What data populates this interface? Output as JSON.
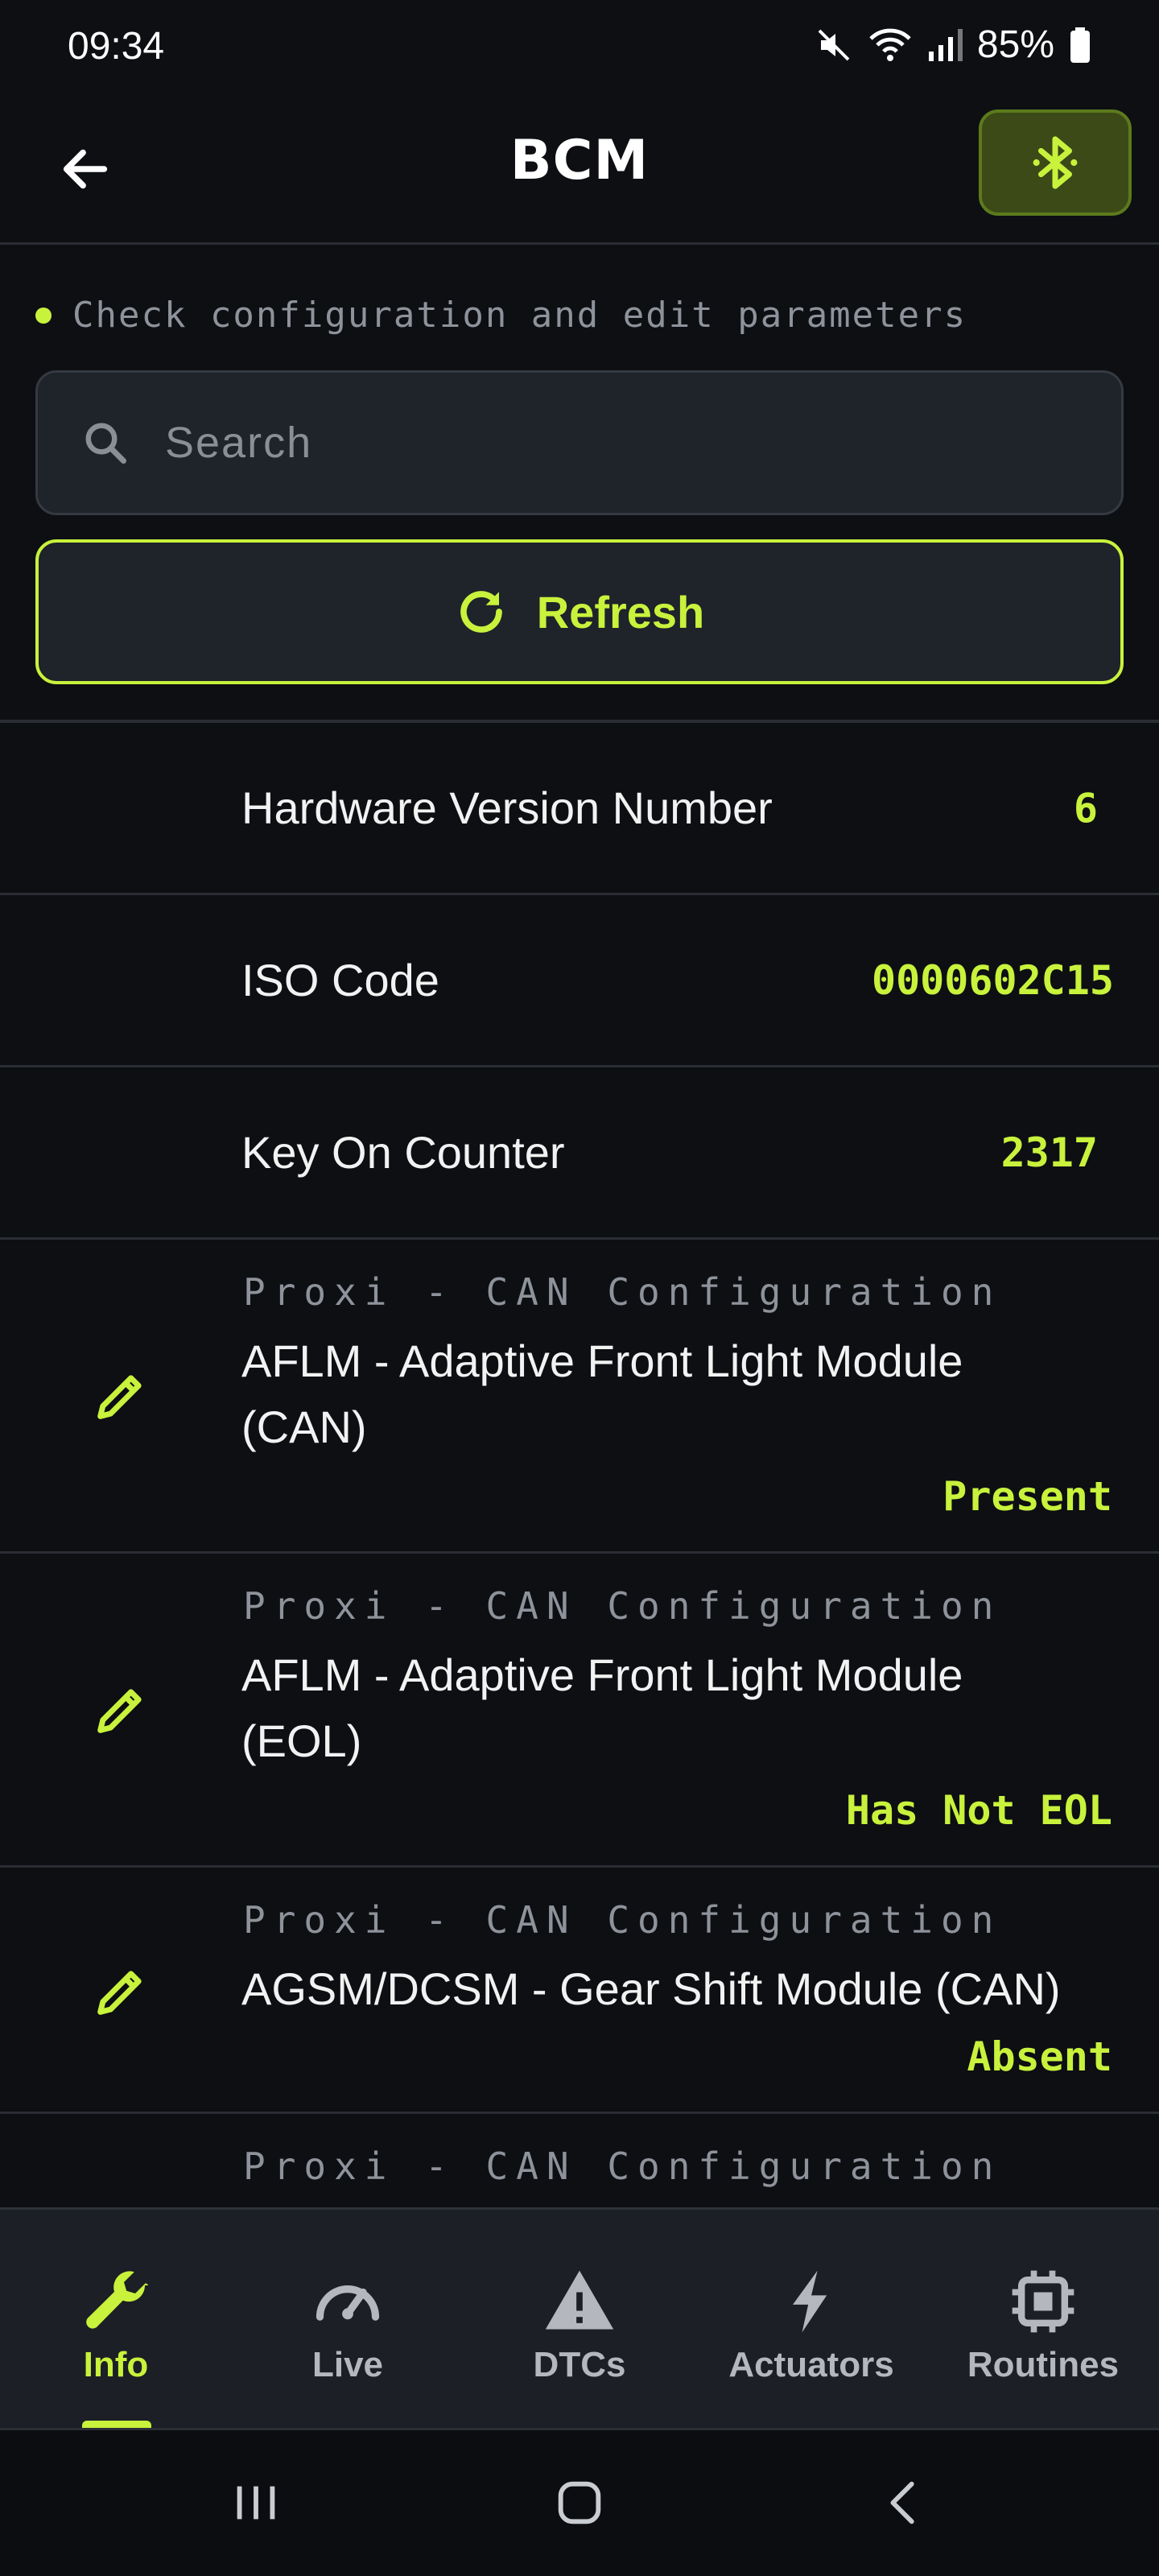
{
  "status_bar": {
    "time": "09:34",
    "battery": "85%",
    "icons": [
      "mute-icon",
      "wifi-icon",
      "signal-icon",
      "battery-icon"
    ]
  },
  "header": {
    "title": "BCM",
    "back_icon": "arrow-left-icon",
    "bluetooth_icon": "bluetooth-icon"
  },
  "subtitle": "Check configuration and edit parameters",
  "search": {
    "placeholder": "Search",
    "value": ""
  },
  "refresh": {
    "label": "Refresh"
  },
  "info_rows": [
    {
      "label": "Hardware Version Number",
      "value": "6"
    },
    {
      "label": "ISO Code",
      "value": "0000602C15"
    },
    {
      "label": "Key On Counter",
      "value": "2317"
    }
  ],
  "config_rows": [
    {
      "category": "Proxi - CAN Configuration",
      "name": "AFLM - Adaptive Front Light Module (CAN)",
      "value": "Present"
    },
    {
      "category": "Proxi - CAN Configuration",
      "name": "AFLM - Adaptive Front Light Module (EOL)",
      "value": "Has Not EOL"
    },
    {
      "category": "Proxi - CAN Configuration",
      "name": "AGSM/DCSM - Gear Shift Module (CAN)",
      "value": "Absent"
    },
    {
      "category": "Proxi - CAN Configuration",
      "name": "",
      "value": ""
    }
  ],
  "bottom_nav": {
    "active": "Info",
    "items": [
      {
        "label": "Info",
        "icon": "wrench-icon"
      },
      {
        "label": "Live",
        "icon": "gauge-icon"
      },
      {
        "label": "DTCs",
        "icon": "warning-icon"
      },
      {
        "label": "Actuators",
        "icon": "lightning-icon"
      },
      {
        "label": "Routines",
        "icon": "chip-icon"
      }
    ]
  },
  "system_nav": {
    "icons": [
      "recents-icon",
      "home-icon",
      "back-icon"
    ]
  },
  "colors": {
    "accent": "#c8f23c",
    "background": "#0d0f13",
    "surface": "#1f232a",
    "muted_text": "#8e939b"
  }
}
